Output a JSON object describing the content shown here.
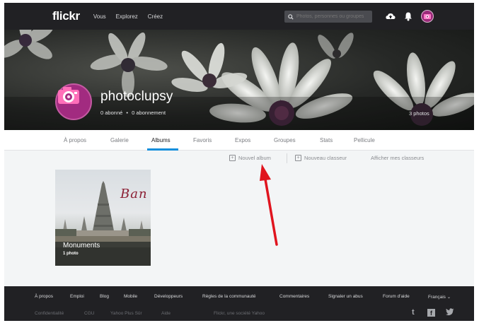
{
  "topnav": {
    "logo": "flickr",
    "links": [
      "Vous",
      "Explorez",
      "Créez"
    ],
    "search_placeholder": "Photos, personnes ou groupes",
    "icons": [
      "search-icon",
      "upload-cloud-icon",
      "bell-icon",
      "avatar"
    ]
  },
  "profile": {
    "name": "photoclupsy",
    "followers": "0 abonné",
    "separator": "•",
    "following": "0 abonnement",
    "photos": "3 photos"
  },
  "subnav": {
    "items": [
      "À propos",
      "Galerie",
      "Albums",
      "Favoris",
      "Expos",
      "Groupes",
      "Stats",
      "Pellicule"
    ],
    "active": "Albums"
  },
  "actions": {
    "new_album": "Nouvel album",
    "new_collection": "Nouveau classeur",
    "show_collections": "Afficher mes classeurs"
  },
  "album": {
    "title": "Monuments",
    "count": "1 photo",
    "cover_text": "Ban"
  },
  "footer": {
    "row1": [
      "À propos",
      "Emploi",
      "Blog",
      "Mobile",
      "Développeurs",
      "Règles de la communauté",
      "Commentaires",
      "Signaler un abus",
      "Forum d'aide",
      "Français ⌄"
    ],
    "row2": [
      "Confidentialité",
      "CGU",
      "Yahoo Plus Sûr",
      "Aide",
      "Flickr, une société Yahoo"
    ],
    "social": [
      "t",
      "f",
      "y"
    ]
  },
  "colors": {
    "nav_bg": "#212124",
    "accent": "#128fdc",
    "arrow": "#e0141e",
    "avatar": "#a22b80"
  }
}
